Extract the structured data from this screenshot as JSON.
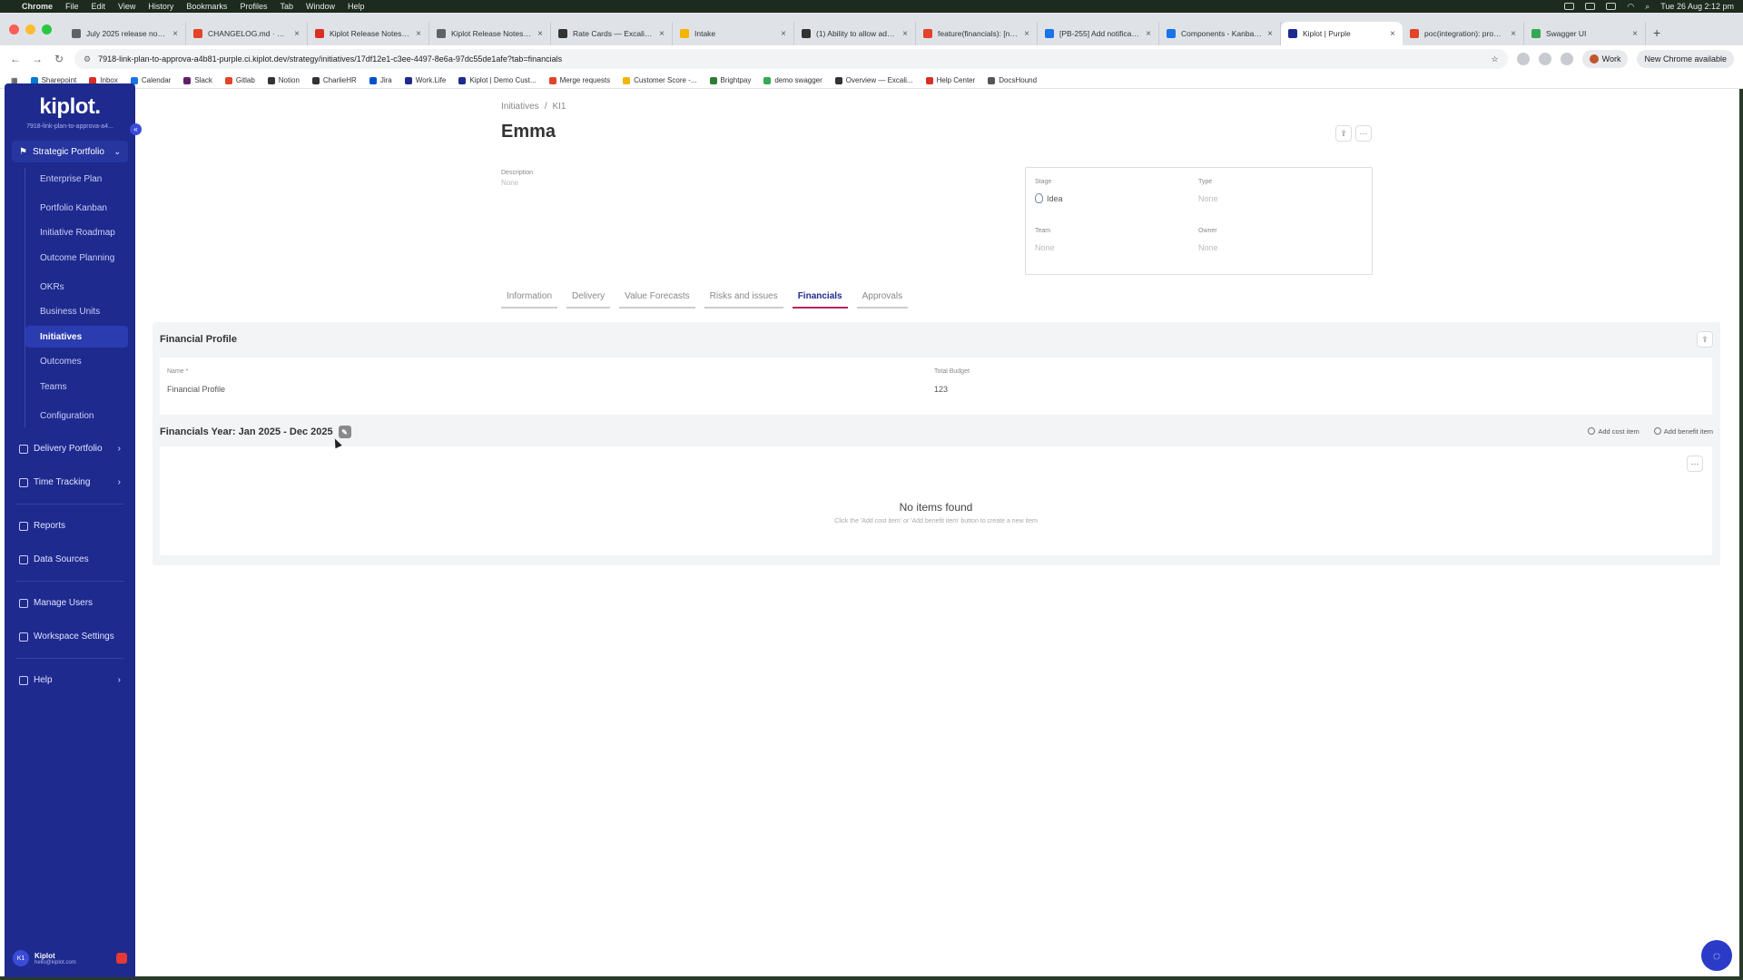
{
  "menubar": {
    "app": "Chrome",
    "items": [
      "File",
      "Edit",
      "View",
      "History",
      "Bookmarks",
      "Profiles",
      "Tab",
      "Window",
      "Help"
    ],
    "clock": "Tue 26 Aug  2:12 pm"
  },
  "tabs": [
    {
      "title": "July 2025 release notes",
      "color": "#5f6368"
    },
    {
      "title": "CHANGELOG.md · master",
      "color": "#e24329"
    },
    {
      "title": "Kiplot Release Notes | Kipl",
      "color": "#d93025"
    },
    {
      "title": "Kiplot Release Notes - Kipl",
      "color": "#5f6368"
    },
    {
      "title": "Rate Cards — Excalidraw P",
      "color": "#333333"
    },
    {
      "title": "Intake",
      "color": "#f4b400"
    },
    {
      "title": "(1) Ability to allow admin u",
      "color": "#333333"
    },
    {
      "title": "feature(financials): [nsa] a",
      "color": "#e24329"
    },
    {
      "title": "[PB-255] Add notification",
      "color": "#1a73e8"
    },
    {
      "title": "Components - Kanban Boa",
      "color": "#1a73e8"
    },
    {
      "title": "Kiplot | Purple",
      "color": "#1e2a8e",
      "active": true
    },
    {
      "title": "poc(integration): proof of c",
      "color": "#e24329"
    },
    {
      "title": "Swagger UI",
      "color": "#34a853"
    }
  ],
  "address": {
    "url": "7918-link-plan-to-approva-a4b81-purple.ci.kiplot.dev/strategy/initiatives/17df12e1-c3ee-4497-8e6a-97dc55de1afe?tab=financials",
    "profile": "Work",
    "update": "New Chrome available"
  },
  "bookmarks": [
    {
      "label": "Sharepoint",
      "color": "#0078d4"
    },
    {
      "label": "Inbox",
      "color": "#d93025"
    },
    {
      "label": "Calendar",
      "color": "#1a73e8"
    },
    {
      "label": "Slack",
      "color": "#611f69"
    },
    {
      "label": "Gitlab",
      "color": "#e24329"
    },
    {
      "label": "Notion",
      "color": "#333333"
    },
    {
      "label": "CharlieHR",
      "color": "#333333"
    },
    {
      "label": "Jira",
      "color": "#0052cc"
    },
    {
      "label": "Work.Life",
      "color": "#1e2a8e"
    },
    {
      "label": "Kiplot | Demo Cust...",
      "color": "#1e2a8e"
    },
    {
      "label": "Merge requests",
      "color": "#e24329"
    },
    {
      "label": "Customer Score -...",
      "color": "#f4b400"
    },
    {
      "label": "Brightpay",
      "color": "#2e7d32"
    },
    {
      "label": "demo swagger",
      "color": "#34a853"
    },
    {
      "label": "Overview — Excali...",
      "color": "#333333"
    },
    {
      "label": "Help Center",
      "color": "#d93025"
    },
    {
      "label": "DocsHound",
      "color": "#555555"
    }
  ],
  "sidebar": {
    "logo": "kiplot.",
    "workspace": "7918-link-plan-to-approva-a4...",
    "section": "Strategic Portfolio",
    "sub_items": [
      {
        "label": "Enterprise Plan"
      },
      {
        "label": "Portfolio Kanban",
        "gap": true
      },
      {
        "label": "Initiative Roadmap"
      },
      {
        "label": "Outcome Planning"
      },
      {
        "label": "OKRs",
        "gap": true
      },
      {
        "label": "Business Units"
      },
      {
        "label": "Initiatives",
        "active": true
      },
      {
        "label": "Outcomes"
      },
      {
        "label": "Teams"
      },
      {
        "label": "Configuration",
        "gap": true
      }
    ],
    "nav": [
      {
        "label": "Delivery Portfolio",
        "chevron": true
      },
      {
        "label": "Time Tracking",
        "chevron": true
      },
      {
        "label": "Reports",
        "sep_before": true
      },
      {
        "label": "Data Sources"
      },
      {
        "label": "Manage Users",
        "sep_before": true
      },
      {
        "label": "Workspace Settings"
      },
      {
        "label": "Help",
        "chevron": true,
        "sep_before": true
      }
    ],
    "user": {
      "initials": "K1",
      "name": "Kiplot",
      "email": "hello@kiplot.com"
    }
  },
  "page": {
    "breadcrumb": [
      "Initiatives",
      "KI1"
    ],
    "title": "Emma",
    "description_label": "Description",
    "description_value": "None",
    "properties": {
      "stage_label": "Stage",
      "stage_value": "Idea",
      "type_label": "Type",
      "type_value": "None",
      "team_label": "Team",
      "team_value": "None",
      "owner_label": "Owner",
      "owner_value": "None"
    },
    "tabs": [
      "Information",
      "Delivery",
      "Value Forecasts",
      "Risks and issues",
      "Financials",
      "Approvals"
    ],
    "active_tab": "Financials"
  },
  "financials": {
    "profile_title": "Financial Profile",
    "name_label": "Name *",
    "name_value": "Financial Profile",
    "budget_label": "Total Budget",
    "budget_value": "123",
    "year_title": "Financials Year: Jan 2025 - Dec 2025",
    "add_cost": "Add cost item",
    "add_benefit": "Add benefit item",
    "empty_title": "No items found",
    "empty_sub": "Click the 'Add cost item' or 'Add benefit item' button to create a new item"
  }
}
